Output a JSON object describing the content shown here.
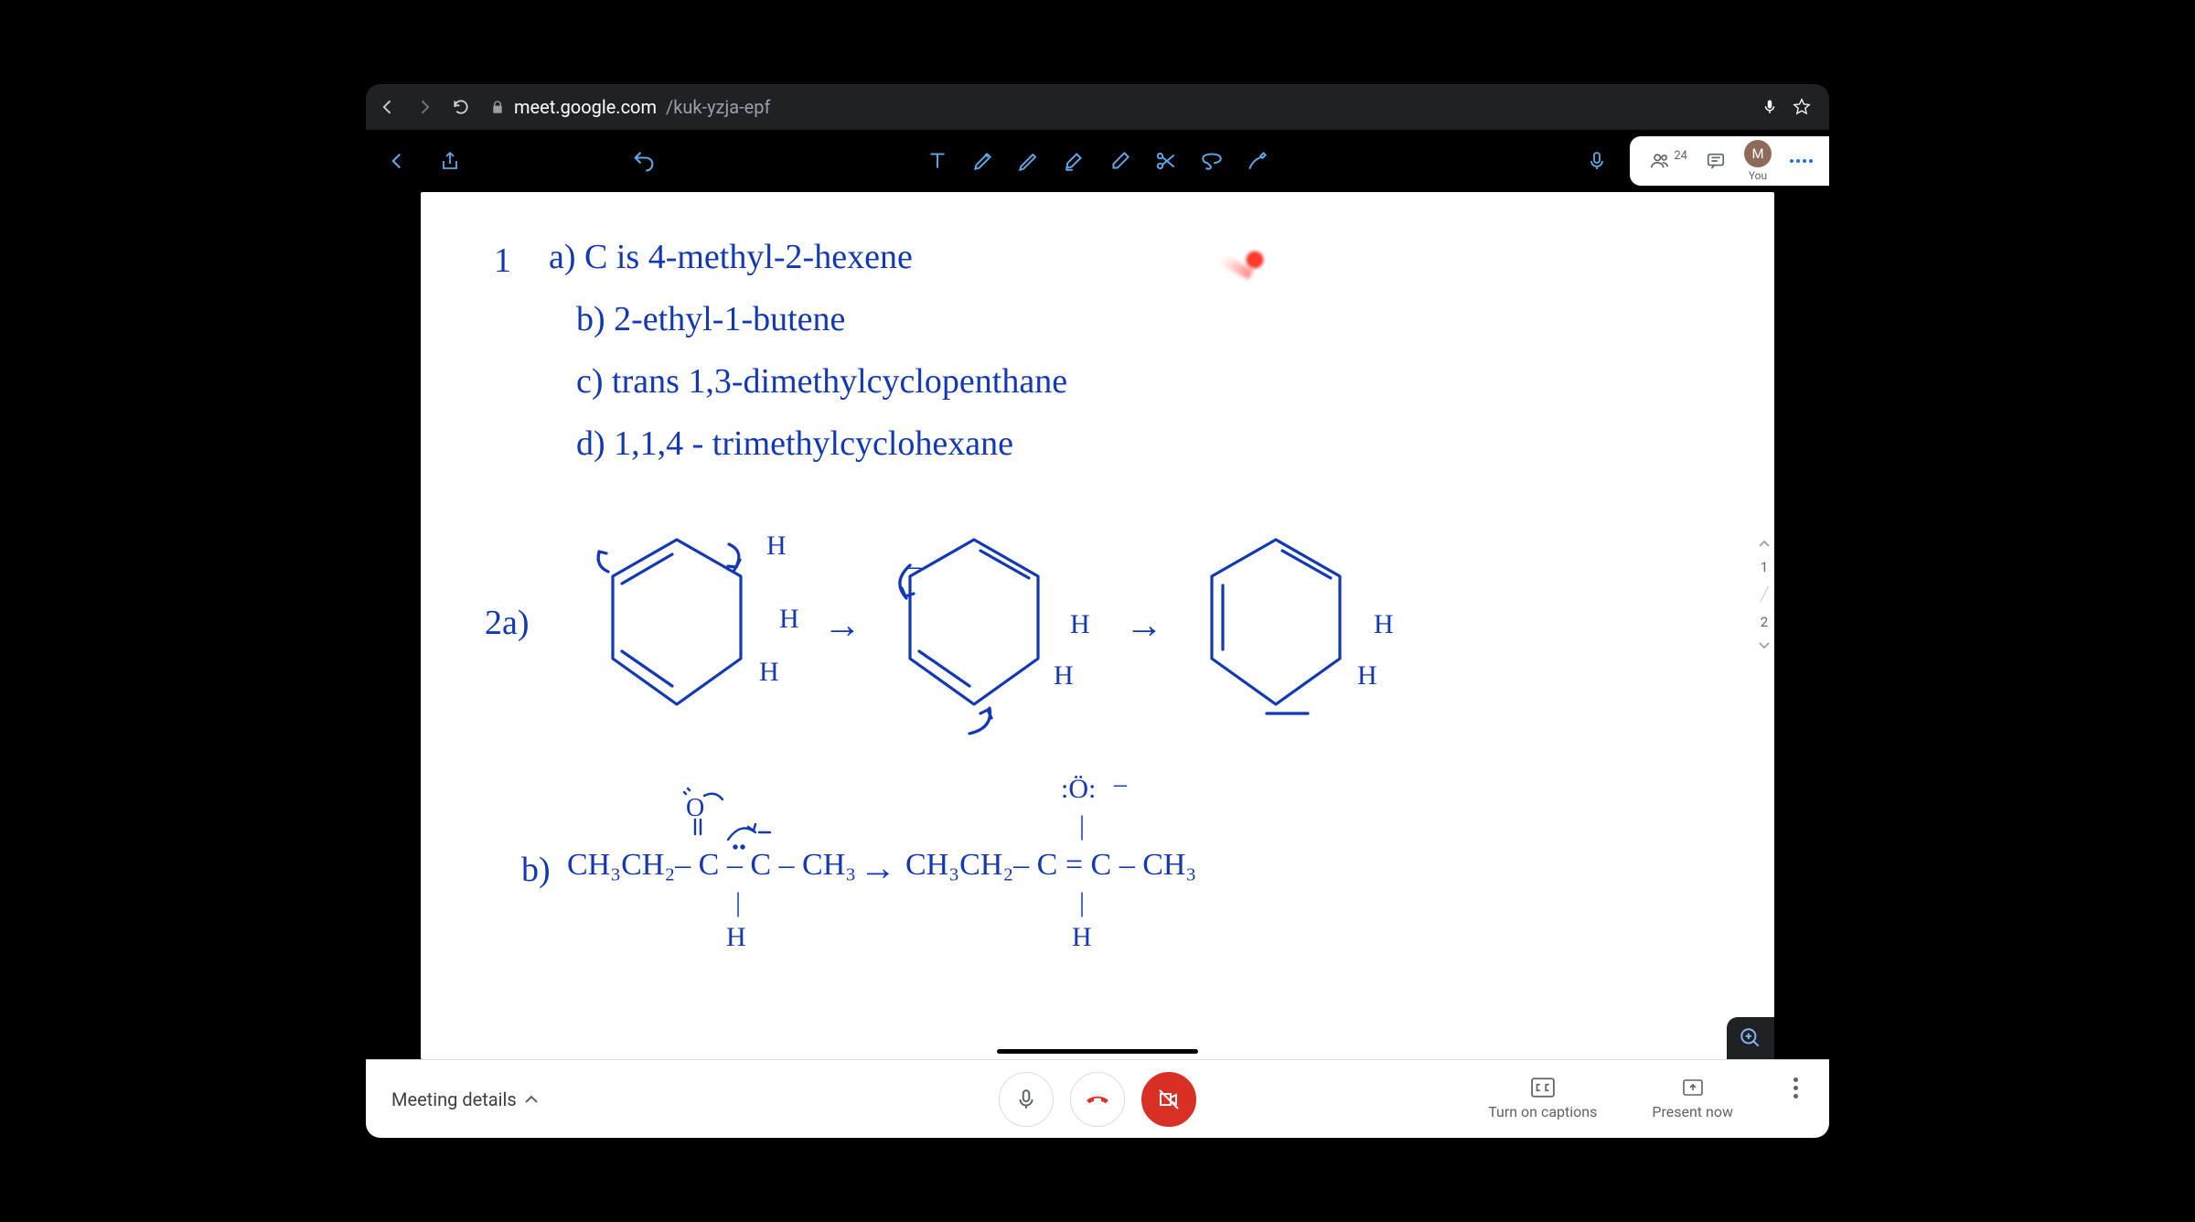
{
  "chrome": {
    "url_host": "meet.google.com",
    "url_path": "/kuk-yzja-epf"
  },
  "pill": {
    "participant_count": "24",
    "avatar_initial": "M",
    "you_label": "You"
  },
  "board": {
    "line1_prefix": "1",
    "line1_a": "a)  C is 4-methyl-2-hexene",
    "line1_b": "b) 2-ethyl-1-butene",
    "line1_c": "c) trans 1,3-dimethylcyclopenthane",
    "line1_d": "d)  1,1,4 - trimethylcyclohexane",
    "q2_label": "2a)",
    "h_labels": [
      "H",
      "H",
      "H",
      "H",
      "H",
      "H",
      "H"
    ],
    "b_label": "b)",
    "formula_left": "CH₃CH₂– C – C – CH₃",
    "formula_arrow": "→",
    "formula_right": "CH₃CH₂– C = C – CH₃",
    "o_top": ":Ö:",
    "o_left": "O",
    "h_bottom": "H",
    "h_right": "H",
    "minus": "–"
  },
  "page_nav": {
    "page": "1",
    "total": "2"
  },
  "meet": {
    "details": "Meeting details",
    "captions": "Turn on captions",
    "present": "Present now"
  }
}
